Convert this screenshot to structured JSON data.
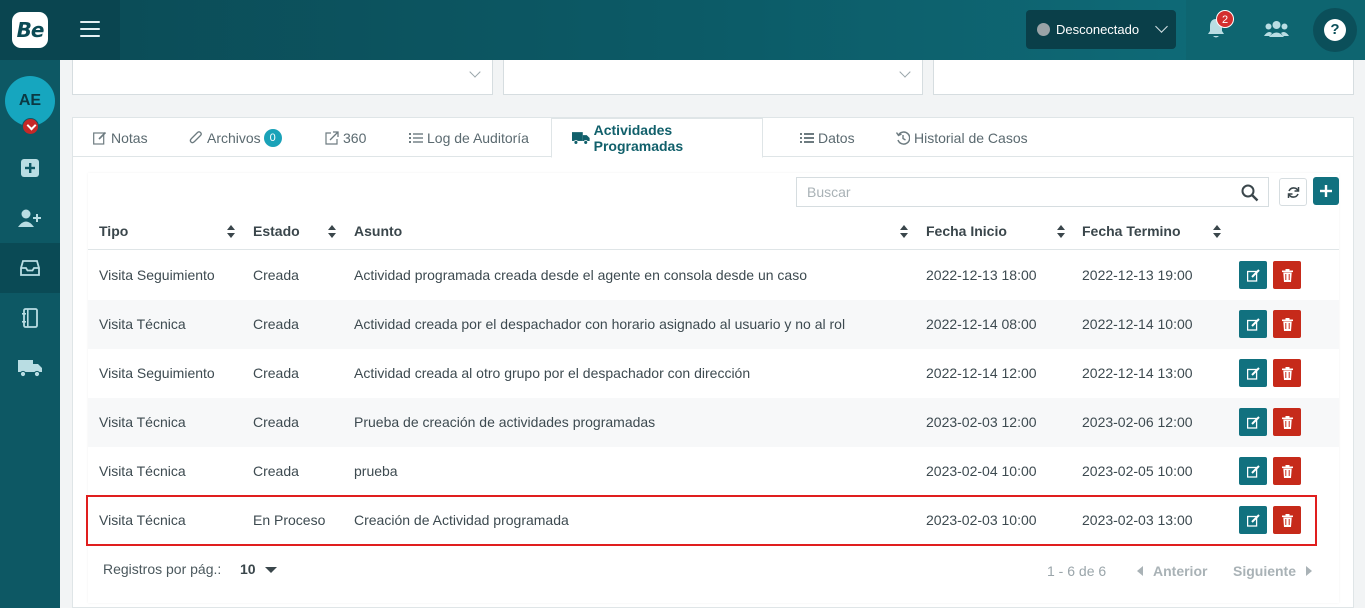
{
  "header": {
    "logo_text": "Be",
    "status": "Desconectado",
    "notifications_count": "2",
    "help_label": "?"
  },
  "sidebar": {
    "avatar_initials": "AE",
    "items": [
      {
        "icon": "plus-square-icon"
      },
      {
        "icon": "user-plus-icon"
      },
      {
        "icon": "inbox-icon",
        "active": true
      },
      {
        "icon": "notebook-icon"
      },
      {
        "icon": "truck-icon"
      }
    ]
  },
  "tabs": {
    "notas": "Notas",
    "archivos": "Archivos",
    "archivos_count": "0",
    "t360": "360",
    "log": "Log de Auditoría",
    "actividades": "Actividades Programadas",
    "datos": "Datos",
    "historial": "Historial de Casos"
  },
  "search": {
    "placeholder": "Buscar"
  },
  "table": {
    "columns": {
      "tipo": "Tipo",
      "estado": "Estado",
      "asunto": "Asunto",
      "inicio": "Fecha Inicio",
      "termino": "Fecha Termino"
    },
    "rows": [
      {
        "tipo": "Visita Seguimiento",
        "estado": "Creada",
        "asunto": "Actividad programada creada desde el agente en consola desde un caso",
        "inicio": "2022-12-13 18:00",
        "termino": "2022-12-13 19:00"
      },
      {
        "tipo": "Visita Técnica",
        "estado": "Creada",
        "asunto": "Actividad creada por el despachador con horario asignado al usuario y no al rol",
        "inicio": "2022-12-14 08:00",
        "termino": "2022-12-14 10:00"
      },
      {
        "tipo": "Visita Seguimiento",
        "estado": "Creada",
        "asunto": "Actividad creada al otro grupo por el despachador con dirección",
        "inicio": "2022-12-14 12:00",
        "termino": "2022-12-14 13:00"
      },
      {
        "tipo": "Visita Técnica",
        "estado": "Creada",
        "asunto": "Prueba de creación de actividades programadas",
        "inicio": "2023-02-03 12:00",
        "termino": "2023-02-06 12:00"
      },
      {
        "tipo": "Visita Técnica",
        "estado": "Creada",
        "asunto": "prueba",
        "inicio": "2023-02-04 10:00",
        "termino": "2023-02-05 10:00"
      },
      {
        "tipo": "Visita Técnica",
        "estado": "En Proceso",
        "asunto": "Creación de Actividad programada",
        "inicio": "2023-02-03 10:00",
        "termino": "2023-02-03 13:00"
      }
    ]
  },
  "pagination": {
    "per_page_label": "Registros por pág.:",
    "per_page_value": "10",
    "range": "1 - 6 de 6",
    "prev": "Anterior",
    "next": "Siguiente"
  },
  "colors": {
    "primary": "#11717f",
    "danger": "#c62a1a",
    "highlight": "#e01e1e"
  }
}
